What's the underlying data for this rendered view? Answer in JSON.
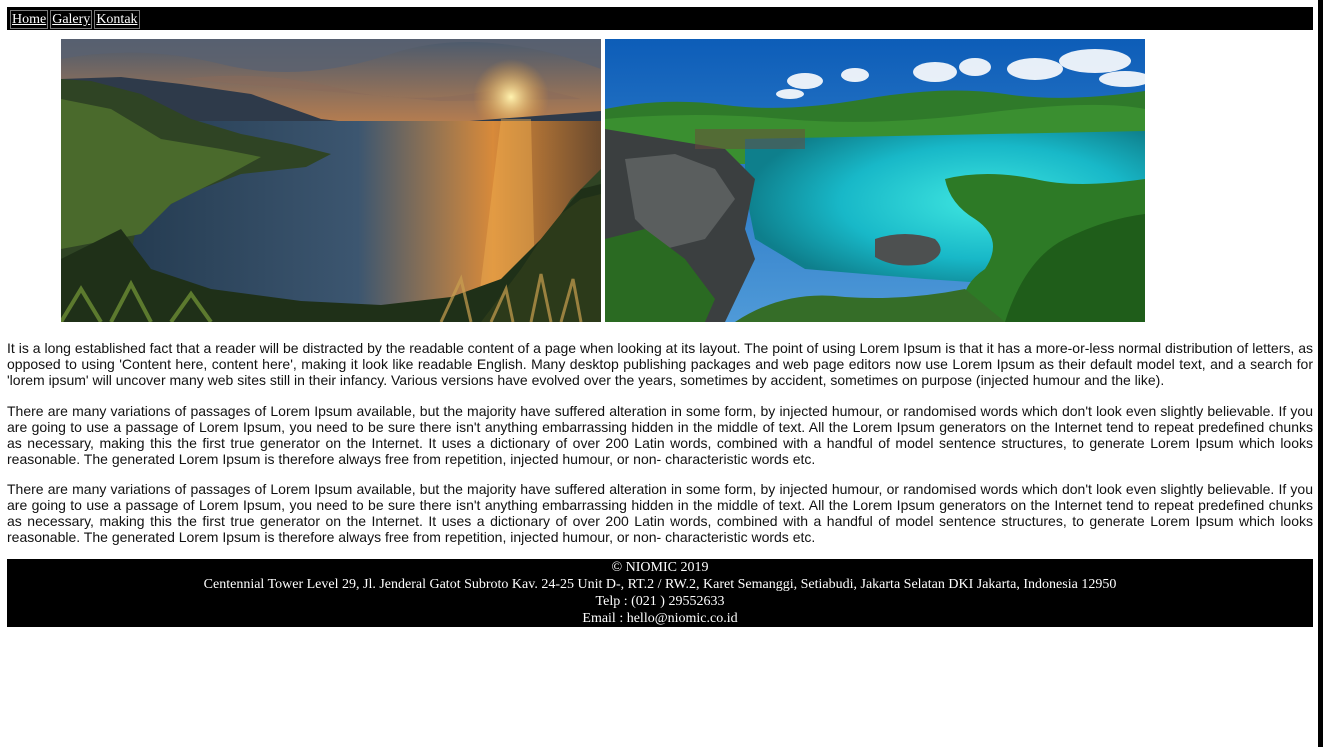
{
  "nav": {
    "items": [
      {
        "label": "Home"
      },
      {
        "label": "Galery"
      },
      {
        "label": "Kontak"
      }
    ]
  },
  "gallery": {
    "images": [
      {
        "name": "lake-sunset-image"
      },
      {
        "name": "turquoise-lagoon-image"
      }
    ]
  },
  "content": {
    "paragraphs": [
      "It is a long established fact that a reader will be distracted by the readable content of a page when looking at its layout. The point of using Lorem Ipsum is that it has a more-or-less normal distribution of letters, as opposed to using 'Content here, content here', making it look like readable English. Many desktop publishing packages and web page editors now use Lorem Ipsum as their default model text, and a search for 'lorem ipsum' will uncover many web sites still in their infancy. Various versions have evolved over the years, sometimes by accident, sometimes on purpose (injected humour and the like).",
      "There are many variations of passages of Lorem Ipsum available, but the majority have suffered alteration in some form, by injected humour, or randomised words which don't look even slightly believable. If you are going to use a passage of Lorem Ipsum, you need to be sure there isn't anything embarrassing hidden in the middle of text. All the Lorem Ipsum generators on the Internet tend to repeat predefined chunks as necessary, making this the first true generator on the Internet. It uses a dictionary of over 200 Latin words, combined with a handful of model sentence structures, to generate Lorem Ipsum which looks reasonable. The generated Lorem Ipsum is therefore always free from repetition, injected humour, or non- characteristic words etc.",
      "There are many variations of passages of Lorem Ipsum available, but the majority have suffered alteration in some form, by injected humour, or randomised words which don't look even slightly believable. If you are going to use a passage of Lorem Ipsum, you need to be sure there isn't anything embarrassing hidden in the middle of text. All the Lorem Ipsum generators on the Internet tend to repeat predefined chunks as necessary, making this the first true generator on the Internet. It uses a dictionary of over 200 Latin words, combined with a handful of model sentence structures, to generate Lorem Ipsum which looks reasonable. The generated Lorem Ipsum is therefore always free from repetition, injected humour, or non- characteristic words etc."
    ]
  },
  "footer": {
    "copyright": "© NIOMIC 2019",
    "address": "Centennial Tower Level 29, Jl. Jenderal Gatot Subroto Kav. 24-25 Unit D-, RT.2 / RW.2, Karet Semanggi, Setiabudi, Jakarta Selatan DKI Jakarta, Indonesia 12950",
    "phone": "Telp : (021 ) 29552633",
    "email": "Email : hello@niomic.co.id"
  }
}
